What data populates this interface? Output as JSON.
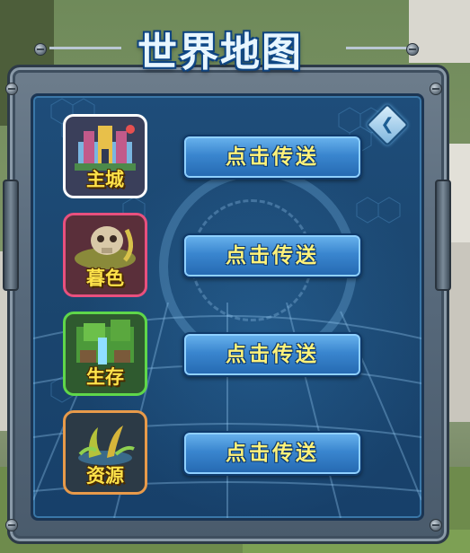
{
  "window": {
    "title": "世界地图"
  },
  "destinations": [
    {
      "name": "主城",
      "button_label": "点击传送",
      "border_color": "#ffffff",
      "bg_color": "#3a3f5a"
    },
    {
      "name": "暮色",
      "button_label": "点击传送",
      "border_color": "#e8507e",
      "bg_color": "#5a2f3a"
    },
    {
      "name": "生存",
      "button_label": "点击传送",
      "border_color": "#5fd74a",
      "bg_color": "#2f5a2f"
    },
    {
      "name": "资源",
      "button_label": "点击传送",
      "border_color": "#e89a4a",
      "bg_color": "#2c3a46"
    }
  ],
  "icons": {
    "back": "back-chevron-icon"
  },
  "colors": {
    "panel": "#1e4d7a",
    "button": "#3a86cf",
    "button_text": "#fff27a",
    "label_text": "#ffe34a",
    "title_text": "#e8f6ff"
  }
}
